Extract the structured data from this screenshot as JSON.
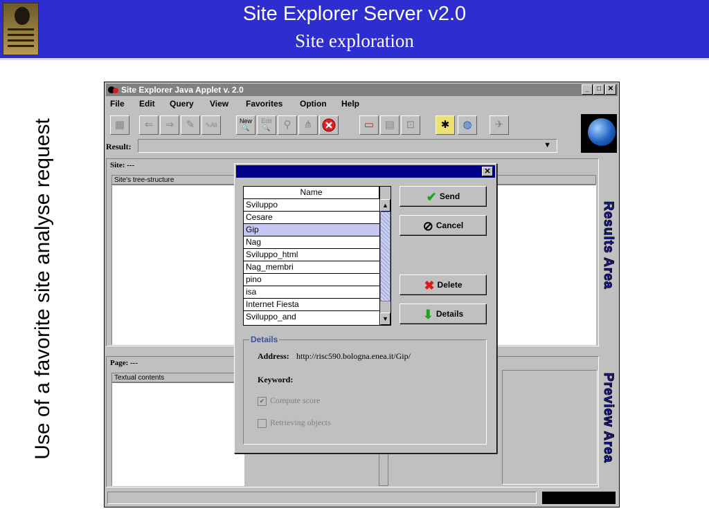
{
  "slide": {
    "title": "Site Explorer Server v2.0",
    "subtitle": "Site exploration",
    "side_caption": "Use of a favorite site analyse request"
  },
  "applet": {
    "window_title": "Site Explorer Java Applet v. 2.0",
    "menu": [
      "File",
      "Edit",
      "Query",
      "View",
      "Favorites",
      "Option",
      "Help"
    ],
    "toolbar": {
      "new_label": "New",
      "edit_label": "Edit",
      "all_label": "All"
    },
    "result_label": "Result:",
    "site_label": "Site: ---",
    "site_tree_header": "Site's tree-structure",
    "results_area_label": "Results Area",
    "page_label": "Page:  ---",
    "textual_contents_header": "Textual contents",
    "preview_area_label": "Preview Area"
  },
  "dialog": {
    "list_header": "Name",
    "items": [
      "Sviluppo",
      "Cesare",
      "Gip",
      "Nag",
      "Sviluppo_html",
      "Nag_membri",
      "pino",
      "isa",
      "Internet Fiesta",
      "Sviluppo_and"
    ],
    "selected_index": 2,
    "buttons": {
      "send": "Send",
      "cancel": "Cancel",
      "delete": "Delete",
      "details": "Details"
    },
    "details": {
      "legend": "Details",
      "address_label": "Address:",
      "address_value": "http://risc590.bologna.enea.it/Gip/",
      "keyword_label": "Keyword:",
      "compute_score": "Compute score",
      "compute_score_checked": true,
      "retrieving_objects": "Retrieving objects",
      "retrieving_objects_checked": false
    }
  },
  "colors": {
    "header_bg": "#2e2ed0",
    "dialog_title_bg": "#00008b",
    "selected_row": "#c6c6f2",
    "area_label": "#1c1cc8"
  }
}
